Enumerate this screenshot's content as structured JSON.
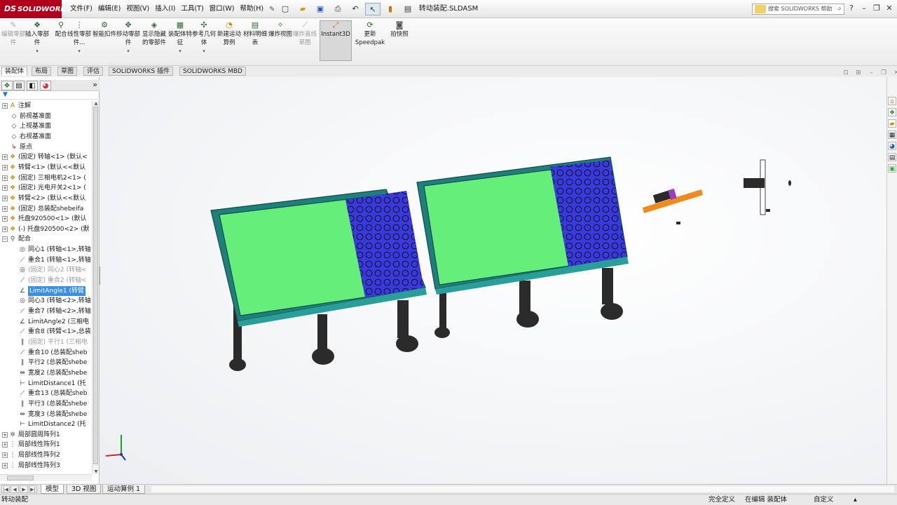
{
  "app": {
    "logo_mark": "DS",
    "logo_text": "SOLIDWORKS",
    "document_title": "转动装配.SLDASM",
    "search_placeholder": "搜索 SOLIDWORKS 帮助",
    "search_icon": "magnifier-icon"
  },
  "menu": [
    {
      "label": "文件(F)"
    },
    {
      "label": "编辑(E)"
    },
    {
      "label": "视图(V)"
    },
    {
      "label": "插入(I)"
    },
    {
      "label": "工具(T)"
    },
    {
      "label": "窗口(W)"
    },
    {
      "label": "帮助(H)"
    }
  ],
  "quick_access": [
    "new-icon",
    "open-icon",
    "save-icon",
    "print-icon",
    "undo-icon",
    "select-icon",
    "rebuild-icon",
    "options-icon"
  ],
  "command_manager": [
    {
      "label": "编辑零部件",
      "state": "disabled",
      "icon": "edit-component-icon"
    },
    {
      "label": "插入零部件",
      "state": "normal",
      "icon": "insert-component-icon",
      "dropdown": true
    },
    {
      "label": "配合",
      "state": "normal",
      "icon": "mate-icon"
    },
    {
      "label": "线性零部件...",
      "state": "normal",
      "icon": "linear-pattern-icon",
      "dropdown": true
    },
    {
      "label": "智能扣件",
      "state": "normal",
      "icon": "smart-fastener-icon"
    },
    {
      "label": "移动零部件",
      "state": "normal",
      "icon": "move-component-icon",
      "dropdown": true
    },
    {
      "label": "显示隐藏的零部件",
      "state": "normal",
      "icon": "show-hidden-icon"
    },
    {
      "label": "装配体特征",
      "state": "normal",
      "icon": "assembly-feature-icon",
      "dropdown": true
    },
    {
      "label": "参考几何体",
      "state": "normal",
      "icon": "reference-geometry-icon",
      "dropdown": true
    },
    {
      "label": "新建运动算例",
      "state": "normal",
      "icon": "motion-study-icon"
    },
    {
      "label": "材料明细表",
      "state": "normal",
      "icon": "bom-icon"
    },
    {
      "label": "爆炸视图",
      "state": "normal",
      "icon": "exploded-view-icon"
    },
    {
      "label": "爆炸直线草图",
      "state": "disabled",
      "icon": "explode-line-icon"
    },
    {
      "label": "Instant3D",
      "state": "active",
      "icon": "instant3d-icon"
    },
    {
      "label": "更新 Speedpak",
      "state": "normal",
      "icon": "speedpak-icon"
    },
    {
      "label": "拍快照",
      "state": "normal",
      "icon": "snapshot-icon"
    }
  ],
  "command_tabs": [
    {
      "label": "装配体",
      "active": true
    },
    {
      "label": "布局",
      "active": false
    },
    {
      "label": "草图",
      "active": false
    },
    {
      "label": "评估",
      "active": false
    },
    {
      "label": "SOLIDWORKS 插件",
      "active": false
    },
    {
      "label": "SOLIDWORKS MBD",
      "active": false
    }
  ],
  "panel_tabs": [
    "feature-manager-icon",
    "property-manager-icon",
    "configuration-manager-icon",
    "appearance-manager-icon"
  ],
  "panel_expand": "»",
  "tree": [
    {
      "label": "注解",
      "icon": "annotation-icon",
      "expander": "+",
      "indent": 0
    },
    {
      "label": "前视基准面",
      "icon": "plane-icon",
      "indent": 1
    },
    {
      "label": "上视基准面",
      "icon": "plane-icon",
      "indent": 1
    },
    {
      "label": "右视基准面",
      "icon": "plane-icon",
      "indent": 1
    },
    {
      "label": "原点",
      "icon": "origin-icon",
      "indent": 1
    },
    {
      "label": "(固定) 转轴<1> (默认<",
      "icon": "part-icon",
      "expander": "+",
      "indent": 0
    },
    {
      "label": "转臂<1> (默认<<默认",
      "icon": "part-icon",
      "expander": "+",
      "indent": 0
    },
    {
      "label": "(固定) 三相电机2<1> (",
      "icon": "part-icon",
      "expander": "+",
      "indent": 0
    },
    {
      "label": "(固定) 光电开关2<1> (",
      "icon": "part-icon",
      "expander": "+",
      "indent": 0
    },
    {
      "label": "转臂<2> (默认<<默认",
      "icon": "part-icon",
      "expander": "+",
      "indent": 0
    },
    {
      "label": "(固定) 总装配shebeifa",
      "icon": "part-icon",
      "expander": "+",
      "indent": 0
    },
    {
      "label": "托盘920500<1> (默认",
      "icon": "part-icon",
      "expander": "+",
      "indent": 0
    },
    {
      "label": "(-) 托盘920500<2> (默",
      "icon": "part-icon",
      "expander": "+",
      "indent": 0
    },
    {
      "label": "配合",
      "icon": "mates-folder-icon",
      "expander": "−",
      "indent": 0
    },
    {
      "label": "同心1 (转轴<1>,转轴",
      "icon": "concentric-icon",
      "indent": 2
    },
    {
      "label": "重合1 (转轴<1>,转轴",
      "icon": "coincident-icon",
      "indent": 2
    },
    {
      "label": "(固定) 同心2 (转轴<",
      "icon": "concentric-icon",
      "indent": 2,
      "grey": true
    },
    {
      "label": "(固定) 重合2 (转轴<",
      "icon": "coincident-icon",
      "indent": 2,
      "grey": true
    },
    {
      "label": "LimitAngle1 (转臂",
      "icon": "limit-angle-icon",
      "indent": 2,
      "selected": true
    },
    {
      "label": "同心3 (转轴<2>,转轴",
      "icon": "concentric-icon",
      "indent": 2
    },
    {
      "label": "重合7 (转轴<2>,转轴",
      "icon": "coincident-icon",
      "indent": 2
    },
    {
      "label": "LimitAngle2 (三相电",
      "icon": "limit-angle-icon",
      "indent": 2
    },
    {
      "label": "重合8 (转臂<1>,总装",
      "icon": "coincident-icon",
      "indent": 2
    },
    {
      "label": "(固定) 平行1 (三相电",
      "icon": "parallel-icon",
      "indent": 2,
      "grey": true
    },
    {
      "label": "重合10 (总装配sheb",
      "icon": "coincident-icon",
      "indent": 2
    },
    {
      "label": "平行2 (总装配shebe",
      "icon": "parallel-icon",
      "indent": 2
    },
    {
      "label": "宽度2 (总装配shebe",
      "icon": "width-icon",
      "indent": 2
    },
    {
      "label": "LimitDistance1 (托",
      "icon": "limit-distance-icon",
      "indent": 2
    },
    {
      "label": "重合13 (总装配sheb",
      "icon": "coincident-icon",
      "indent": 2
    },
    {
      "label": "平行3 (总装配shebe",
      "icon": "parallel-icon",
      "indent": 2
    },
    {
      "label": "宽度3 (总装配shebe",
      "icon": "width-icon",
      "indent": 2
    },
    {
      "label": "LimitDistance2 (托",
      "icon": "limit-distance-icon",
      "indent": 2
    },
    {
      "label": "局部圆周阵列1",
      "icon": "circular-pattern-icon",
      "expander": "+",
      "indent": 0
    },
    {
      "label": "局部线性阵列1",
      "icon": "linear-pattern-icon",
      "expander": "+",
      "indent": 0
    },
    {
      "label": "局部线性阵列2",
      "icon": "linear-pattern-icon",
      "expander": "+",
      "indent": 0
    },
    {
      "label": "局部线性阵列3",
      "icon": "linear-pattern-icon",
      "expander": "+",
      "indent": 0
    }
  ],
  "heads_up_toolbar": [
    "zoom-to-fit-icon",
    "zoom-area-icon",
    "previous-view-icon",
    "section-view-icon",
    "dynamic-annotation-icon",
    "view-orientation-icon",
    "display-style-icon",
    "hide-show-icon",
    "edit-appearance-icon",
    "apply-scene-icon",
    "view-settings-icon"
  ],
  "colors": {
    "frame": "#1f7f7a",
    "deck": "#66ee7a",
    "roller_panel": "#3939e0",
    "leg": "#2b2b2b",
    "arm_orange": "#f08a1c",
    "arm_purple": "#9a3fc0"
  },
  "bottom_tabs": [
    {
      "label": "模型",
      "active": true
    },
    {
      "label": "3D 视图",
      "active": false
    },
    {
      "label": "运动算例 1",
      "active": false
    }
  ],
  "status": {
    "left": "转动装配",
    "definition": "完全定义",
    "mode": "在编辑 装配体",
    "units": "自定义"
  }
}
